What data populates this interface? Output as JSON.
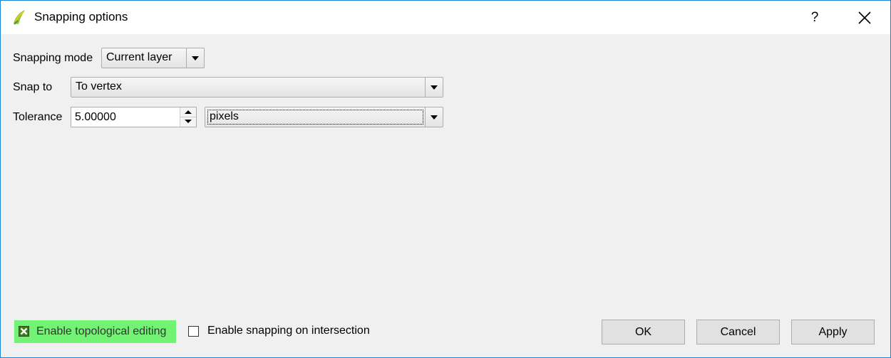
{
  "window": {
    "title": "Snapping options",
    "help_label": "?",
    "accent_color": "#1883d7"
  },
  "icons": {
    "app": "qgis-logo-icon",
    "close": "close-icon",
    "checked": "green-x-check-icon"
  },
  "form": {
    "snapping_mode": {
      "label": "Snapping mode",
      "value": "Current layer"
    },
    "snap_to": {
      "label": "Snap to",
      "value": "To vertex"
    },
    "tolerance": {
      "label": "Tolerance",
      "value": "5.00000",
      "unit": "pixels"
    }
  },
  "options": {
    "topological_editing": {
      "label": "Enable topological editing",
      "checked": true,
      "highlight_color": "#73f373"
    },
    "snapping_on_intersection": {
      "label": "Enable snapping on intersection",
      "checked": false
    }
  },
  "buttons": {
    "ok": "OK",
    "cancel": "Cancel",
    "apply": "Apply"
  }
}
